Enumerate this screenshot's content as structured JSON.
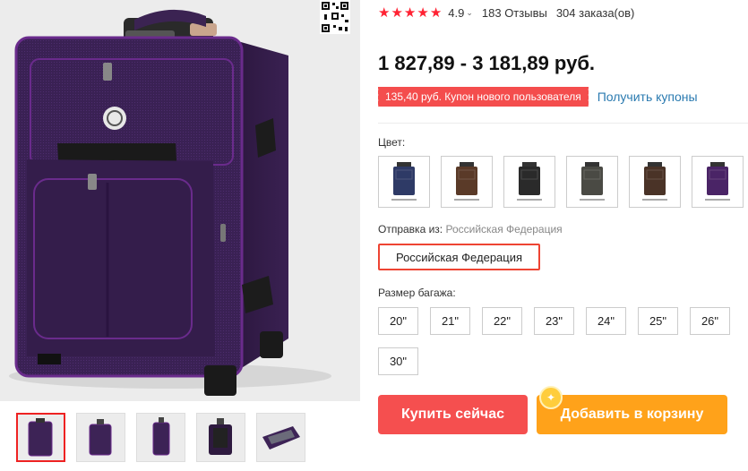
{
  "product": {
    "rating": {
      "stars": 5,
      "value": "4.9",
      "reviews": "183 Отзывы",
      "orders": "304 заказа(ов)"
    },
    "price": "1 827,89 - 3 181,89 руб.",
    "coupon": {
      "text": "135,40 руб. Купон нового пользователя",
      "link": "Получить купоны"
    },
    "color": {
      "label": "Цвет:",
      "options": [
        {
          "name": "navy",
          "hex": "#2e3a66"
        },
        {
          "name": "brown",
          "hex": "#5a3a28"
        },
        {
          "name": "black",
          "hex": "#2a2a2a"
        },
        {
          "name": "gray",
          "hex": "#4a4a44"
        },
        {
          "name": "coffee",
          "hex": "#4a3327"
        },
        {
          "name": "purple",
          "hex": "#4a2466"
        }
      ]
    },
    "shipping": {
      "label": "Отправка из:",
      "value": "Российская Федерация",
      "selected": "Российская Федерация"
    },
    "size": {
      "label": "Размер багажа:",
      "options": [
        "20\"",
        "21\"",
        "22\"",
        "23\"",
        "24\"",
        "25\"",
        "26\"",
        "30\""
      ]
    },
    "actions": {
      "buy": "Купить сейчас",
      "cart": "Добавить в корзину"
    }
  },
  "colors": {
    "accent_red": "#f54f4f",
    "accent_orange": "#ffa21a",
    "link_blue": "#2a7ab0",
    "star_red": "#f23333",
    "suitcase_purple": "#3d2356"
  }
}
